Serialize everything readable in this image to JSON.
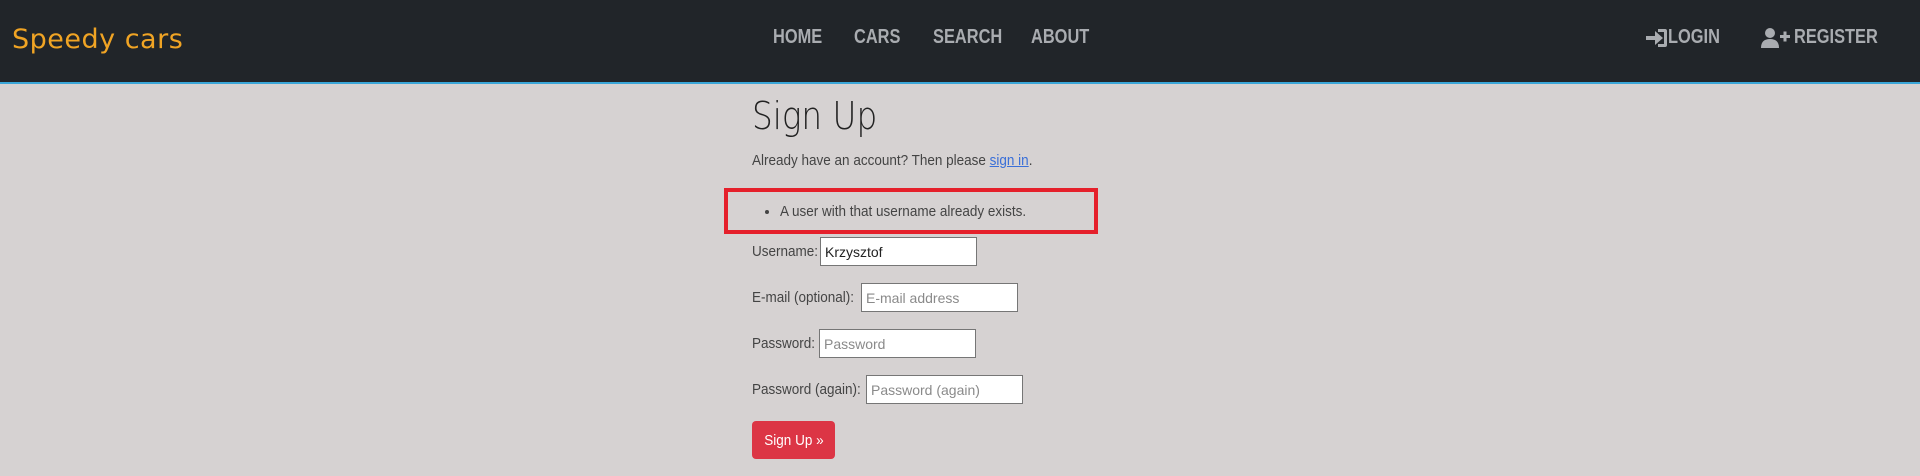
{
  "nav": {
    "brand": "Speedy cars",
    "links": [
      "HOME",
      "CARS",
      "SEARCH",
      "ABOUT"
    ],
    "login": "LOGIN",
    "register": "REGISTER",
    "login_icon": "sign-in-icon",
    "register_icon": "user-plus-icon"
  },
  "page": {
    "title": "Sign Up",
    "already_text": "Already have an account? Then please ",
    "signin_link": "sign in",
    "already_suffix": "."
  },
  "errors": [
    "A user with that username already exists."
  ],
  "form": {
    "username_label": "Username:",
    "username_value": "Krzysztof",
    "email_label": "E-mail (optional):",
    "email_placeholder": "E-mail address",
    "password_label": "Password:",
    "password_placeholder": "Password",
    "password2_label": "Password (again):",
    "password2_placeholder": "Password (again)",
    "submit_label": "Sign Up »"
  },
  "colors": {
    "navbar_bg": "#212529",
    "brand": "#f0a424",
    "page_bg": "#d6d2d2",
    "error_border": "#e5202b",
    "submit_bg": "#dc3545",
    "link": "#3a6fd8"
  }
}
